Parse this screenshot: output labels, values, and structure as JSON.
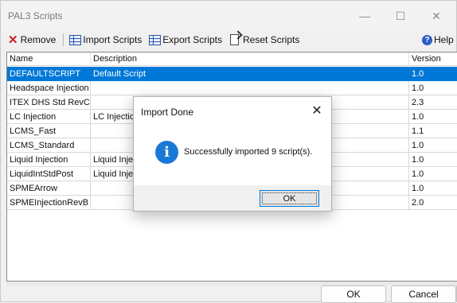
{
  "window": {
    "title": "PAL3 Scripts",
    "minimize": "—",
    "maximize": "☐",
    "close": "✕"
  },
  "toolbar": {
    "remove_label": "Remove",
    "import_label": "Import Scripts",
    "export_label": "Export Scripts",
    "reset_label": "Reset Scripts",
    "help_label": "Help"
  },
  "table": {
    "columns": [
      "Name",
      "Description",
      "Version"
    ],
    "rows": [
      {
        "name": "DEFAULTSCRIPT",
        "description": "Default Script",
        "version": "1.0"
      },
      {
        "name": "Headspace Injection",
        "description": "",
        "version": "1.0"
      },
      {
        "name": "ITEX DHS Std RevC",
        "description": "",
        "version": "2.3"
      },
      {
        "name": "LC Injection",
        "description": "LC Injection",
        "version": "1.0"
      },
      {
        "name": "LCMS_Fast",
        "description": "",
        "version": "1.1"
      },
      {
        "name": "LCMS_Standard",
        "description": "",
        "version": "1.0"
      },
      {
        "name": "Liquid Injection",
        "description": "Liquid Inject",
        "version": "1.0"
      },
      {
        "name": "LiquidIntStdPost",
        "description": "Liquid Inject",
        "version": "1.0"
      },
      {
        "name": "SPMEArrow",
        "description": "",
        "version": "1.0"
      },
      {
        "name": "SPMEInjectionRevB",
        "description": "",
        "version": "2.0"
      }
    ]
  },
  "footer": {
    "ok_label": "OK",
    "cancel_label": "Cancel"
  },
  "dialog": {
    "title": "Import Done",
    "close": "✕",
    "message": "Successfully imported 9 script(s).",
    "ok_label": "OK"
  }
}
